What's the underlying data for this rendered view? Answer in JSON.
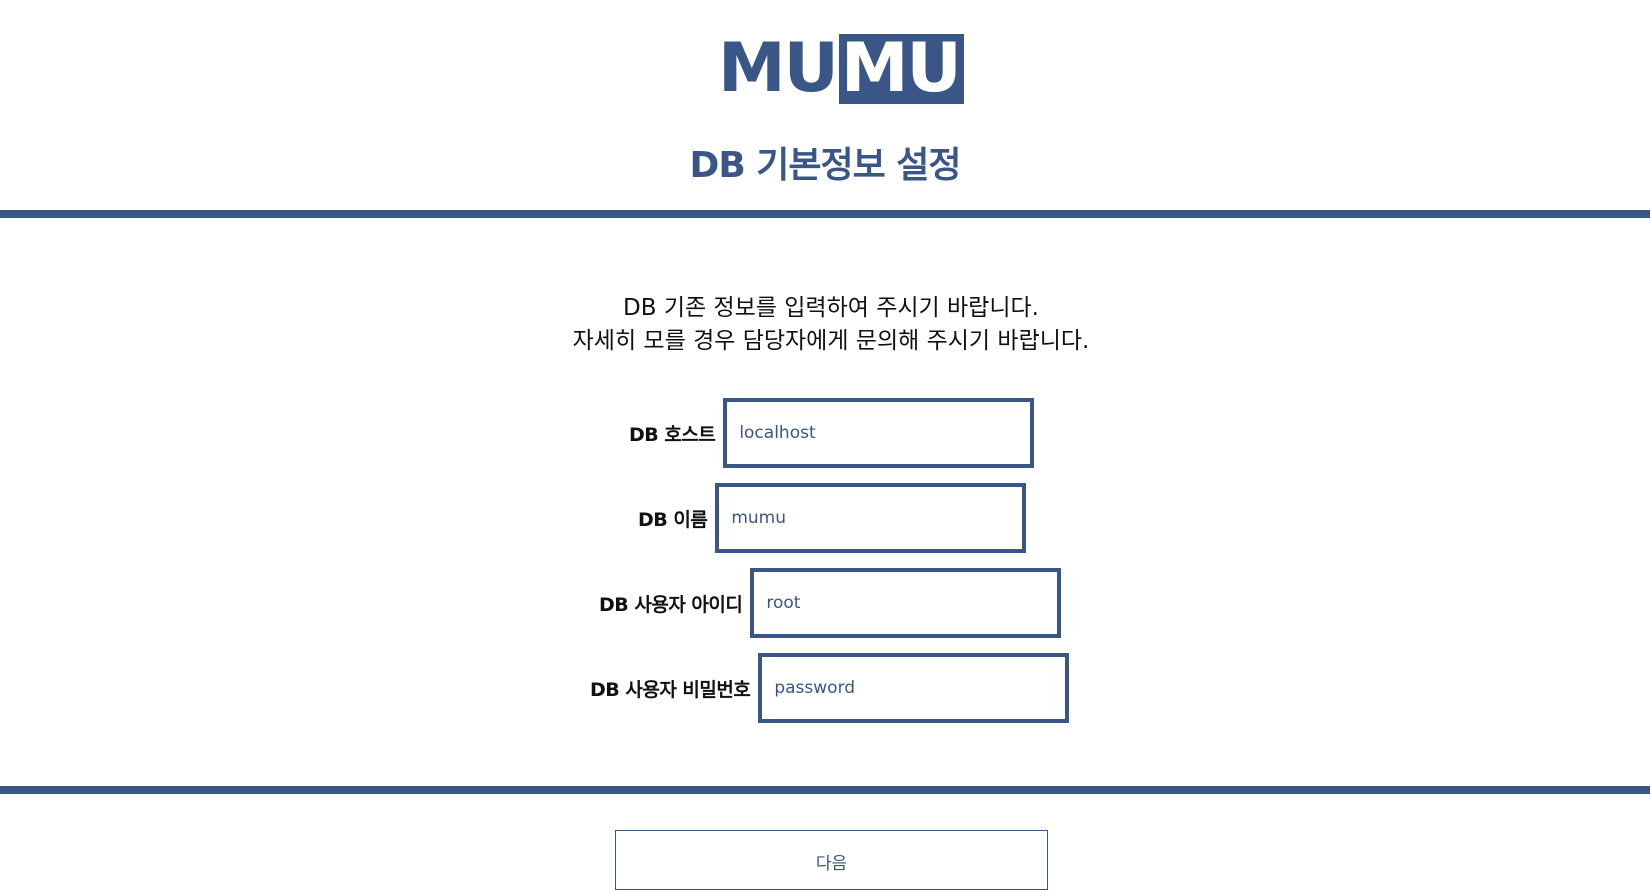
{
  "brand": {
    "logo_part1": "MU",
    "logo_part2": "MU",
    "color": "#3a5686"
  },
  "header": {
    "title": "DB 기본정보 설정"
  },
  "intro": {
    "line1": "DB 기존 정보를 입력하여 주시기 바랍니다.",
    "line2": "자세히 모를 경우 담당자에게 문의해 주시기 바랍니다."
  },
  "form": {
    "fields": [
      {
        "label": "DB 호스트",
        "value": "localhost",
        "placeholder": ""
      },
      {
        "label": "DB 이름",
        "value": "mumu",
        "placeholder": ""
      },
      {
        "label": "DB 사용자 아이디",
        "value": "root",
        "placeholder": ""
      },
      {
        "label": "DB 사용자 비밀번호",
        "value": "",
        "placeholder": "password"
      }
    ]
  },
  "actions": {
    "next_label": "다음"
  }
}
